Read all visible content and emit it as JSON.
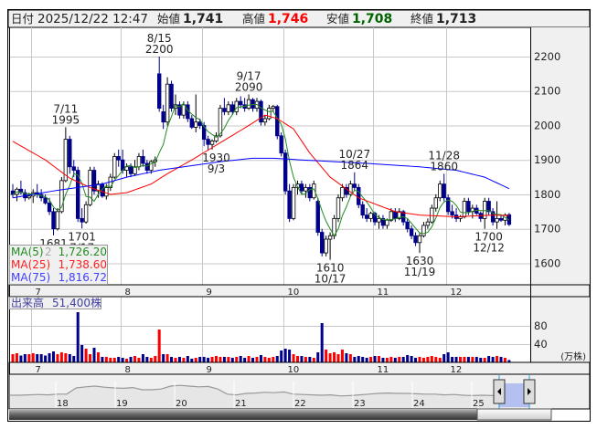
{
  "header": {
    "date_label": "日付",
    "datetime": "2025/12/22 12:47",
    "open_label": "始値",
    "open": "1,741",
    "high_label": "高値",
    "high": "1,746",
    "low_label": "安値",
    "low": "1,708",
    "close_label": "終値",
    "close": "1,713"
  },
  "legend": {
    "ma5_label": "MA(5)",
    "ma5_suffix": "2",
    "ma5": "1,726.20",
    "ma25_label": "MA(25)",
    "ma25": "1,738.60",
    "ma75_label": "MA(75)",
    "ma75": "1,816.72"
  },
  "volume_label": {
    "label": "出来高",
    "value": "51,400株"
  },
  "colors": {
    "up_body": "#ffffff",
    "down_body": "#00008b",
    "vol_up": "#ff0000",
    "vol_down": "#00008b",
    "ma5": "#228b22",
    "ma25": "#ff0000",
    "ma75": "#0000ff",
    "grid": "#c8c8c8",
    "high_text": "#ff0000",
    "low_text": "#006400"
  },
  "chart_data": {
    "type": "candlestick",
    "price_axis": {
      "ticks": [
        2200,
        2100,
        2000,
        1900,
        1800,
        1700,
        1600
      ],
      "range": [
        1540,
        2270
      ]
    },
    "volume_axis": {
      "ticks": [
        80,
        40
      ],
      "unit": "(万株)",
      "range": [
        0,
        145
      ]
    },
    "months": [
      {
        "label": "7",
        "start": 5
      },
      {
        "label": "8",
        "start": 27
      },
      {
        "label": "9",
        "start": 47
      },
      {
        "label": "10",
        "start": 67
      },
      {
        "label": "11",
        "start": 89
      },
      {
        "label": "12",
        "start": 107
      }
    ],
    "ohlc": [
      [
        1810,
        1830,
        1790,
        1800
      ],
      [
        1800,
        1820,
        1780,
        1815
      ],
      [
        1815,
        1840,
        1800,
        1805
      ],
      [
        1805,
        1815,
        1780,
        1790
      ],
      [
        1790,
        1805,
        1785,
        1795
      ],
      [
        1795,
        1815,
        1775,
        1805
      ],
      [
        1805,
        1830,
        1790,
        1800
      ],
      [
        1800,
        1815,
        1780,
        1790
      ],
      [
        1790,
        1800,
        1770,
        1775
      ],
      [
        1775,
        1790,
        1740,
        1750
      ],
      [
        1750,
        1760,
        1681,
        1700
      ],
      [
        1700,
        1760,
        1695,
        1750
      ],
      [
        1750,
        1850,
        1745,
        1840
      ],
      [
        1840,
        1995,
        1835,
        1960
      ],
      [
        1960,
        1970,
        1860,
        1880
      ],
      [
        1880,
        1900,
        1850,
        1870
      ],
      [
        1870,
        1880,
        1720,
        1730
      ],
      [
        1730,
        1760,
        1701,
        1720
      ],
      [
        1720,
        1780,
        1715,
        1770
      ],
      [
        1770,
        1880,
        1765,
        1870
      ],
      [
        1870,
        1880,
        1800,
        1810
      ],
      [
        1810,
        1840,
        1790,
        1830
      ],
      [
        1830,
        1835,
        1790,
        1795
      ],
      [
        1795,
        1830,
        1785,
        1820
      ],
      [
        1820,
        1860,
        1810,
        1850
      ],
      [
        1850,
        1920,
        1845,
        1910
      ],
      [
        1910,
        1930,
        1880,
        1900
      ],
      [
        1900,
        1930,
        1860,
        1870
      ],
      [
        1870,
        1890,
        1850,
        1880
      ],
      [
        1880,
        1890,
        1850,
        1860
      ],
      [
        1860,
        1900,
        1855,
        1880
      ],
      [
        1880,
        1920,
        1870,
        1910
      ],
      [
        1910,
        1930,
        1880,
        1890
      ],
      [
        1890,
        1900,
        1860,
        1870
      ],
      [
        1870,
        1900,
        1860,
        1895
      ],
      [
        1895,
        1910,
        1880,
        1900
      ],
      [
        2150,
        2200,
        2040,
        2050
      ],
      [
        2040,
        2060,
        1990,
        2010
      ],
      [
        2010,
        2140,
        2000,
        2120
      ],
      [
        2120,
        2130,
        2040,
        2050
      ],
      [
        2050,
        2090,
        2030,
        2060
      ],
      [
        2060,
        2070,
        2020,
        2030
      ],
      [
        2030,
        2070,
        2020,
        2060
      ],
      [
        2060,
        2070,
        2010,
        2020
      ],
      [
        2020,
        2030,
        1990,
        1995
      ],
      [
        1995,
        2090,
        1980,
        2010
      ],
      [
        2010,
        2020,
        1990,
        2000
      ],
      [
        2000,
        2010,
        1940,
        1960
      ],
      [
        1960,
        1970,
        1930,
        1945
      ],
      [
        1945,
        1960,
        1930,
        1955
      ],
      [
        1955,
        1980,
        1950,
        1970
      ],
      [
        1970,
        2060,
        1965,
        2050
      ],
      [
        2050,
        2080,
        2030,
        2040
      ],
      [
        2040,
        2070,
        2030,
        2060
      ],
      [
        2060,
        2070,
        2030,
        2040
      ],
      [
        2040,
        2080,
        2030,
        2070
      ],
      [
        2070,
        2085,
        2050,
        2060
      ],
      [
        2060,
        2080,
        2040,
        2050
      ],
      [
        2050,
        2090,
        2045,
        2075
      ],
      [
        2075,
        2080,
        2040,
        2050
      ],
      [
        2050,
        2080,
        2040,
        2070
      ],
      [
        2070,
        2075,
        2000,
        2010
      ],
      [
        2010,
        2030,
        2000,
        2020
      ],
      [
        2020,
        2060,
        2015,
        2050
      ],
      [
        2050,
        2060,
        2040,
        2055
      ],
      [
        2055,
        2060,
        1960,
        1970
      ],
      [
        1970,
        1980,
        1910,
        1920
      ],
      [
        1920,
        1930,
        1800,
        1810
      ],
      [
        1810,
        1830,
        1720,
        1730
      ],
      [
        1730,
        1830,
        1725,
        1820
      ],
      [
        1820,
        1840,
        1800,
        1830
      ],
      [
        1830,
        1840,
        1800,
        1810
      ],
      [
        1810,
        1830,
        1790,
        1820
      ],
      [
        1820,
        1830,
        1780,
        1790
      ],
      [
        1790,
        1840,
        1785,
        1830
      ],
      [
        1780,
        1790,
        1680,
        1690
      ],
      [
        1690,
        1700,
        1620,
        1630
      ],
      [
        1630,
        1680,
        1620,
        1670
      ],
      [
        1670,
        1690,
        1610,
        1680
      ],
      [
        1680,
        1740,
        1670,
        1730
      ],
      [
        1730,
        1800,
        1720,
        1790
      ],
      [
        1790,
        1830,
        1780,
        1820
      ],
      [
        1820,
        1830,
        1790,
        1800
      ],
      [
        1800,
        1840,
        1795,
        1830
      ],
      [
        1830,
        1864,
        1810,
        1820
      ],
      [
        1820,
        1830,
        1760,
        1770
      ],
      [
        1770,
        1780,
        1730,
        1740
      ],
      [
        1740,
        1760,
        1720,
        1730
      ],
      [
        1730,
        1750,
        1720,
        1745
      ],
      [
        1745,
        1750,
        1710,
        1720
      ],
      [
        1720,
        1740,
        1700,
        1730
      ],
      [
        1730,
        1740,
        1700,
        1710
      ],
      [
        1710,
        1730,
        1700,
        1725
      ],
      [
        1725,
        1760,
        1720,
        1750
      ],
      [
        1750,
        1760,
        1720,
        1730
      ],
      [
        1730,
        1760,
        1725,
        1750
      ],
      [
        1750,
        1755,
        1710,
        1720
      ],
      [
        1720,
        1730,
        1690,
        1700
      ],
      [
        1700,
        1710,
        1670,
        1680
      ],
      [
        1680,
        1690,
        1650,
        1660
      ],
      [
        1660,
        1690,
        1630,
        1680
      ],
      [
        1680,
        1720,
        1675,
        1710
      ],
      [
        1710,
        1730,
        1700,
        1720
      ],
      [
        1720,
        1770,
        1715,
        1760
      ],
      [
        1760,
        1800,
        1750,
        1790
      ],
      [
        1790,
        1840,
        1780,
        1830
      ],
      [
        1830,
        1860,
        1780,
        1790
      ],
      [
        1790,
        1800,
        1740,
        1750
      ],
      [
        1750,
        1770,
        1730,
        1740
      ],
      [
        1740,
        1760,
        1720,
        1730
      ],
      [
        1730,
        1740,
        1720,
        1735
      ],
      [
        1735,
        1790,
        1730,
        1780
      ],
      [
        1780,
        1790,
        1740,
        1750
      ],
      [
        1750,
        1770,
        1730,
        1760
      ],
      [
        1760,
        1770,
        1740,
        1745
      ],
      [
        1745,
        1750,
        1720,
        1730
      ],
      [
        1730,
        1790,
        1700,
        1780
      ],
      [
        1780,
        1790,
        1740,
        1750
      ],
      [
        1750,
        1760,
        1710,
        1720
      ],
      [
        1720,
        1780,
        1700,
        1730
      ],
      [
        1730,
        1740,
        1720,
        1725
      ],
      [
        1725,
        1745,
        1710,
        1740
      ],
      [
        1741,
        1746,
        1708,
        1713
      ]
    ],
    "volume": [
      18,
      20,
      15,
      18,
      18,
      20,
      18,
      18,
      15,
      20,
      24,
      18,
      22,
      20,
      18,
      14,
      110,
      38,
      30,
      18,
      32,
      22,
      12,
      12,
      10,
      10,
      12,
      10,
      8,
      12,
      14,
      10,
      18,
      12,
      10,
      14,
      72,
      18,
      18,
      12,
      10,
      12,
      10,
      14,
      8,
      10,
      12,
      12,
      10,
      12,
      14,
      12,
      12,
      12,
      10,
      12,
      14,
      10,
      14,
      10,
      12,
      16,
      12,
      10,
      12,
      14,
      26,
      30,
      28,
      18,
      14,
      14,
      12,
      12,
      10,
      22,
      86,
      28,
      20,
      22,
      18,
      28,
      20,
      18,
      12,
      14,
      12,
      10,
      12,
      14,
      14,
      10,
      10,
      12,
      10,
      12,
      12,
      16,
      14,
      10,
      12,
      10,
      12,
      14,
      12,
      10,
      18,
      22,
      12,
      12,
      12,
      12,
      12,
      12,
      12,
      10,
      10,
      14,
      12,
      14,
      12,
      10,
      5.14
    ],
    "ma25_keyframes": [
      [
        0,
        1954
      ],
      [
        8,
        1900
      ],
      [
        14,
        1847
      ],
      [
        19,
        1820
      ],
      [
        24,
        1800
      ],
      [
        28,
        1805
      ],
      [
        34,
        1830
      ],
      [
        38,
        1860
      ],
      [
        44,
        1900
      ],
      [
        51,
        1950
      ],
      [
        58,
        2000
      ],
      [
        62,
        2030
      ],
      [
        65,
        2020
      ],
      [
        69,
        1990
      ],
      [
        73,
        1920
      ],
      [
        78,
        1850
      ],
      [
        85,
        1790
      ],
      [
        94,
        1750
      ],
      [
        100,
        1740
      ],
      [
        109,
        1735
      ],
      [
        118,
        1740
      ],
      [
        122,
        1738.6
      ]
    ],
    "ma75_keyframes": [
      [
        0,
        1790
      ],
      [
        10,
        1810
      ],
      [
        22,
        1830
      ],
      [
        28,
        1850
      ],
      [
        36,
        1870
      ],
      [
        42,
        1880
      ],
      [
        51,
        1895
      ],
      [
        59,
        1905
      ],
      [
        64,
        1905
      ],
      [
        71,
        1900
      ],
      [
        87,
        1890
      ],
      [
        100,
        1880
      ],
      [
        109,
        1870
      ],
      [
        116,
        1850
      ],
      [
        122,
        1816.72
      ]
    ],
    "annotations": [
      {
        "index": 36,
        "price": 2200,
        "pos": "above",
        "date": "8/15",
        "value": "2200"
      },
      {
        "index": 13,
        "price": 1995,
        "pos": "above",
        "date": "7/11",
        "value": "1995"
      },
      {
        "index": 58,
        "price": 2090,
        "pos": "above",
        "date": "9/17",
        "value": "2090"
      },
      {
        "index": 84,
        "price": 1864,
        "pos": "above",
        "date": "10/27",
        "value": "1864"
      },
      {
        "index": 106,
        "price": 1860,
        "pos": "above",
        "date": "11/28",
        "value": "1860"
      },
      {
        "index": 10,
        "price": 1681,
        "pos": "below",
        "value": "1681",
        "date": ""
      },
      {
        "index": 17,
        "price": 1701,
        "pos": "below",
        "value": "1701",
        "date": "7/17"
      },
      {
        "index": 50,
        "price": 1930,
        "pos": "below",
        "value": "1930",
        "date": "9/3"
      },
      {
        "index": 78,
        "price": 1610,
        "pos": "below",
        "value": "1610",
        "date": "10/17"
      },
      {
        "index": 100,
        "price": 1630,
        "pos": "below",
        "value": "1630",
        "date": "11/19"
      },
      {
        "index": 117,
        "price": 1700,
        "pos": "below",
        "value": "1700",
        "date": "12/12"
      }
    ]
  },
  "navigator": {
    "years": [
      "18",
      "19",
      "20",
      "21",
      "22",
      "23",
      "24",
      "25"
    ],
    "series": [
      35,
      35,
      36,
      37,
      36,
      38,
      38,
      55,
      58,
      60,
      57,
      55,
      54,
      56,
      50,
      50,
      52,
      60,
      62,
      60,
      58,
      59,
      52,
      38,
      36,
      40,
      41,
      43,
      42,
      44,
      38,
      37,
      36,
      35,
      36,
      33,
      34,
      36,
      38,
      40,
      41,
      40,
      40,
      39,
      38,
      38,
      36,
      37,
      35,
      34,
      35,
      34,
      36,
      38,
      40,
      42
    ]
  }
}
